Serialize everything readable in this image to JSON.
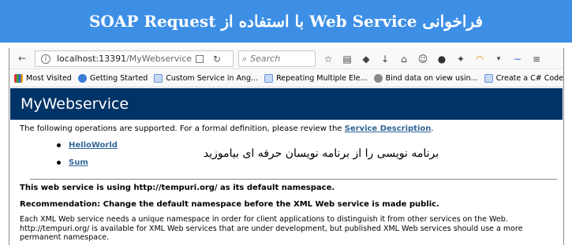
{
  "banner": {
    "title": "فراخوانی Web Service با استفاده از SOAP Request"
  },
  "browser": {
    "url_host": "localhost:13391",
    "url_path": "/MyWebservice.asm",
    "search_placeholder": "Search",
    "toolbar_icons": [
      "star-icon",
      "reading-list-icon",
      "shield-icon",
      "download-icon",
      "home-icon",
      "chat-icon",
      "stop-icon",
      "extension-icon",
      "rainbow-icon",
      "menu-arrow-icon",
      "wave-icon",
      "hamburger-icon"
    ],
    "bookmarks": [
      {
        "label": "Most Visited",
        "icon": "books"
      },
      {
        "label": "Getting Started",
        "icon": "globe"
      },
      {
        "label": "Custom Service in Ang...",
        "icon": "cs"
      },
      {
        "label": "Repeating Multiple Ele...",
        "icon": "cs"
      },
      {
        "label": "Bind data on view usin...",
        "icon": "gray"
      },
      {
        "label": "Create a C# Code Edit...",
        "icon": "cs"
      }
    ]
  },
  "page": {
    "heading": "MyWebservice",
    "intro_text": "The following operations are supported. For a formal definition, please review the ",
    "intro_link": "Service Description",
    "intro_end": ".",
    "operations": [
      "HelloWorld",
      "Sum"
    ],
    "overlay_text": "برنامه نویسی را از برنامه نویسان حرفه ای بیاموزید",
    "namespace_notice": "This web service is using http://tempuri.org/ as its default namespace.",
    "recommendation": "Recommendation: Change the default namespace before the XML Web service is made public.",
    "description": "Each XML Web service needs a unique namespace in order for client applications to distinguish it from other services on the Web. http://tempuri.org/ is available for XML Web services that are under development, but published XML Web services should use a more permanent namespace."
  },
  "colors": {
    "banner": "#3d8fe6",
    "heading_bar": "#003366",
    "link": "#336699"
  }
}
